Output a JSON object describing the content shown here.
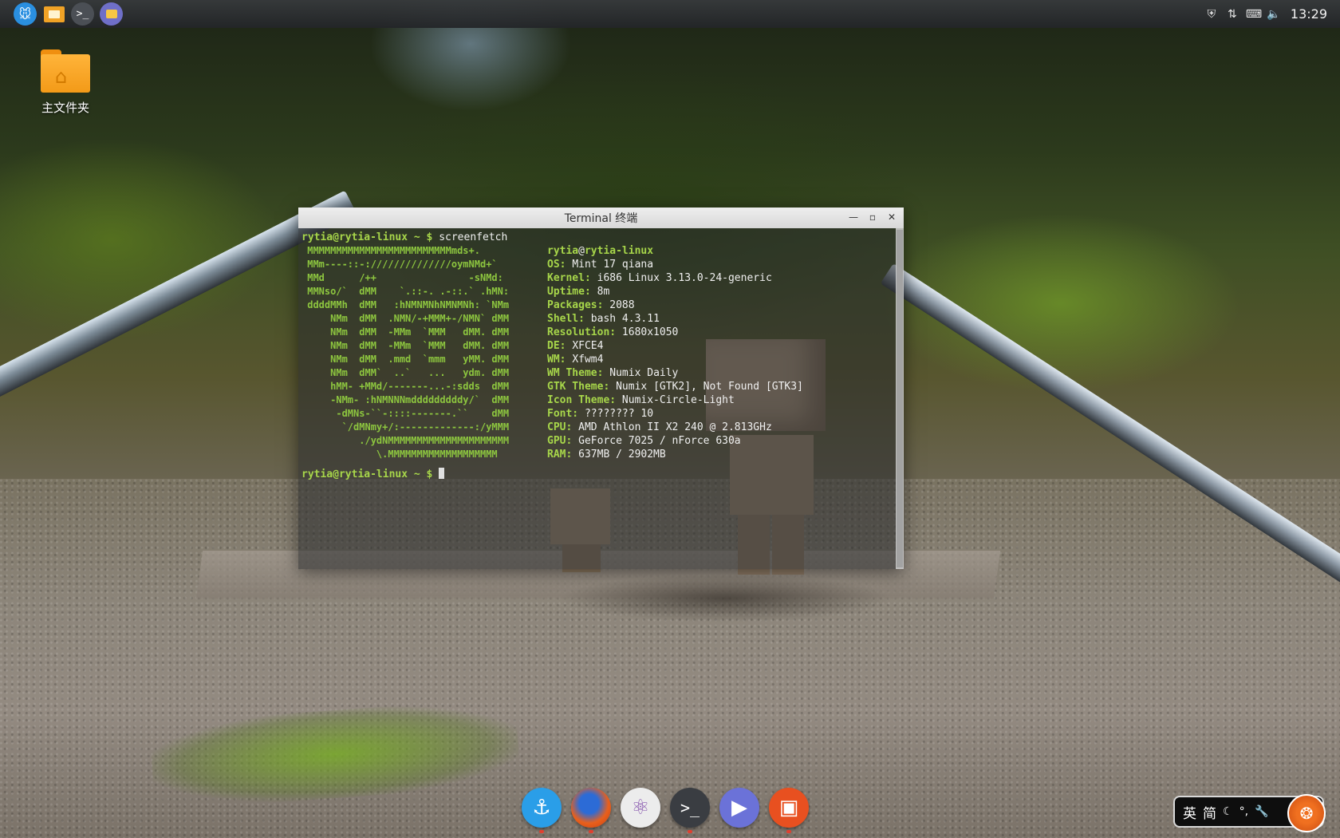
{
  "top_panel": {
    "launchers": [
      {
        "name": "whisker-menu",
        "icon": "mouse-icon"
      },
      {
        "name": "file-manager",
        "icon": "folder-icon"
      },
      {
        "name": "terminal",
        "icon": "terminal-icon",
        "glyph": ">_"
      },
      {
        "name": "home-folder",
        "icon": "folder-icon"
      }
    ],
    "tray": {
      "icons": [
        "shield-icon",
        "network-arrows-icon",
        "keyboard-icon",
        "volume-icon"
      ],
      "clock": "13:29"
    }
  },
  "desktop": {
    "icons": [
      {
        "label": "主文件夹",
        "icon": "home-folder-icon"
      }
    ]
  },
  "terminal": {
    "title": "Terminal 终端",
    "prompt": "rytia@rytia-linux ~ $",
    "command": "screenfetch",
    "logo_lines": [
      " MMMMMMMMMMMMMMMMMMMMMMMMMmds+.",
      " MMm----::-://////////////oymNMd+`",
      " MMd      /++                -sNMd:",
      " MMNso/`  dMM    `.::-. .-::.` .hMN:",
      " ddddMMh  dMM   :hNMNMNhNMNMNh: `NMm",
      "     NMm  dMM  .NMN/-+MMM+-/NMN` dMM",
      "     NMm  dMM  -MMm  `MMM   dMM. dMM",
      "     NMm  dMM  -MMm  `MMM   dMM. dMM",
      "     NMm  dMM  .mmd  `mmm   yMM. dMM",
      "     NMm  dMM`  ..`   ...   ydm. dMM",
      "     hMM- +MMd/-------...-:sdds  dMM",
      "     -NMm- :hNMNNNmdddddddddy/`  dMM",
      "      -dMNs-``-::::-------.``    dMM",
      "       `/dMNmy+/:-------------:/yMMM",
      "          ./ydNMMMMMMMMMMMMMMMMMMMMM",
      "             \\.MMMMMMMMMMMMMMMMMMM"
    ],
    "info_user": "rytia",
    "info_at": "@",
    "info_host": "rytia-linux",
    "info": [
      {
        "key": "OS:",
        "value": "Mint 17 qiana"
      },
      {
        "key": "Kernel:",
        "value": "i686 Linux 3.13.0-24-generic"
      },
      {
        "key": "Uptime:",
        "value": "8m"
      },
      {
        "key": "Packages:",
        "value": "2088"
      },
      {
        "key": "Shell:",
        "value": "bash 4.3.11"
      },
      {
        "key": "Resolution:",
        "value": "1680x1050"
      },
      {
        "key": "DE:",
        "value": "XFCE4"
      },
      {
        "key": "WM:",
        "value": "Xfwm4"
      },
      {
        "key": "WM Theme:",
        "value": "Numix Daily"
      },
      {
        "key": "GTK Theme:",
        "value": "Numix [GTK2], Not Found [GTK3]"
      },
      {
        "key": "Icon Theme:",
        "value": "Numix-Circle-Light"
      },
      {
        "key": "Font:",
        "value": "???????? 10"
      },
      {
        "key": "CPU:",
        "value": "AMD Athlon II X2 240 @ 2.813GHz"
      },
      {
        "key": "GPU:",
        "value": "GeForce 7025 / nForce 630a"
      },
      {
        "key": "RAM:",
        "value": "637MB / 2902MB"
      }
    ],
    "prompt2": "rytia@rytia-linux ~ $"
  },
  "dock": {
    "items": [
      {
        "name": "anchor-app",
        "icon": "anchor-icon",
        "glyph": "⚓"
      },
      {
        "name": "firefox",
        "icon": "firefox-icon",
        "glyph": ""
      },
      {
        "name": "atom-editor",
        "icon": "atom-icon",
        "glyph": "⚛"
      },
      {
        "name": "terminal",
        "icon": "terminal-icon",
        "glyph": ">_"
      },
      {
        "name": "media-player",
        "icon": "play-icon",
        "glyph": "▶"
      },
      {
        "name": "software-store",
        "icon": "store-icon",
        "glyph": "▣"
      }
    ]
  },
  "input_method": {
    "lang": "英",
    "script": "简",
    "icons": [
      "moon-icon",
      "punctuation-icon",
      "wrench-icon",
      "sogou-logo-icon"
    ]
  }
}
